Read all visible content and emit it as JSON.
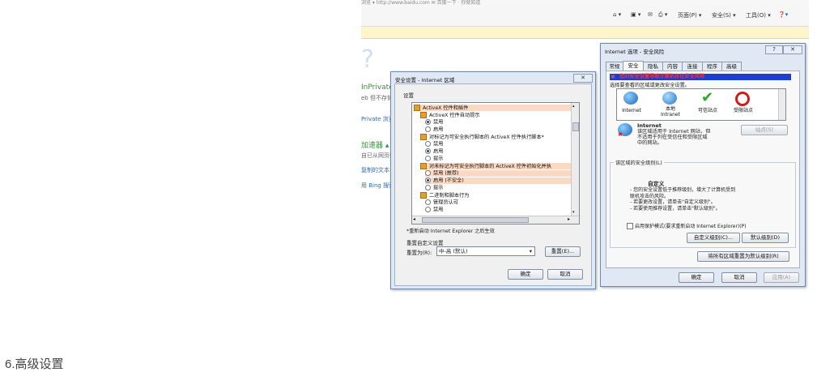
{
  "caption": "6.高级设置",
  "browser": {
    "top_strip": "浏览 ▾  http://www.baidu.com   ✉ 百度一下 · 你就知道",
    "commands": [
      "页面(P) ▾",
      "安全(S) ▾",
      "工具(O) ▾"
    ],
    "page_text": {
      "qmark": "?",
      "line1": "InPrivate",
      "line2": "eb 但不存储",
      "line3": "Private 浏览",
      "line4": "加速器 ▴",
      "line5": "自已从网页中",
      "line6": "复制的文本",
      "line7": "用 Bing 搜索"
    }
  },
  "security_settings": {
    "title": "安全设置 - Internet 区域",
    "settings_label": "设置",
    "items": [
      {
        "kind": "category",
        "text": "ActiveX 控件和插件",
        "highlight": true
      },
      {
        "kind": "category",
        "text": "ActiveX 控件自动提示",
        "highlight": false
      },
      {
        "kind": "radio",
        "text": "禁用",
        "checked": true,
        "highlight": false
      },
      {
        "kind": "radio",
        "text": "启用",
        "checked": false,
        "highlight": false
      },
      {
        "kind": "category",
        "text": "对标记为可安全执行脚本的 ActiveX 控件执行脚本*",
        "highlight": false
      },
      {
        "kind": "radio",
        "text": "禁用",
        "checked": false,
        "highlight": false
      },
      {
        "kind": "radio",
        "text": "启用",
        "checked": true,
        "highlight": false
      },
      {
        "kind": "radio",
        "text": "提示",
        "checked": false,
        "highlight": false
      },
      {
        "kind": "category",
        "text": "对未标记为可安全执行脚本的 ActiveX 控件初始化并执",
        "highlight": true
      },
      {
        "kind": "radio",
        "text": "禁用 (推荐)",
        "checked": false,
        "highlight": true
      },
      {
        "kind": "radio",
        "text": "启用 (不安全)",
        "checked": true,
        "highlight": true
      },
      {
        "kind": "radio",
        "text": "提示",
        "checked": false,
        "highlight": false
      },
      {
        "kind": "category",
        "text": "二进制和脚本行为",
        "highlight": false
      },
      {
        "kind": "radio",
        "text": "管理员认可",
        "checked": false,
        "highlight": false
      },
      {
        "kind": "radio",
        "text": "禁用",
        "checked": false,
        "highlight": false
      }
    ],
    "restart_note": "*重新启动 Internet Explorer 之后生效",
    "reset_section": "重置自定义设置",
    "reset_to_label": "重置为(R):",
    "reset_select": "中-高 (默认)",
    "reset_button": "重置(E)...",
    "ok": "确定",
    "cancel": "取消"
  },
  "internet_options": {
    "title": "Internet 选项 - 安全风险",
    "tabs": [
      "常规",
      "安全",
      "隐私",
      "内容",
      "连接",
      "程序",
      "高级"
    ],
    "warning": "您的安全设置导致计算机存在安全风险",
    "instruction": "选择要查看的区域或更改安全设置。",
    "zones": [
      {
        "line1": "Internet",
        "line2": ""
      },
      {
        "line1": "本地",
        "line2": "Intranet"
      },
      {
        "line1": "可信站点",
        "line2": ""
      },
      {
        "line1": "受限站点",
        "line2": ""
      }
    ],
    "zone_name": "Internet",
    "zone_desc": [
      "该区域适用于 Internet 网站，但",
      "不适用于列在受信任和受限区域",
      "中的网站。"
    ],
    "sites_button": "站点(S)",
    "level_group": "该区域的安全级别(L)",
    "custom_title": "自定义",
    "custom_lines": [
      "- 您的安全设置低于推荐级别，增大了计算机受到",
      "联机攻击的风险。",
      "- 若要更改设置，请单击\"自定义级别\"。",
      "- 若要使用推荐设置，请单击\"默认级别\"。"
    ],
    "protected_mode": "启用保护模式(要求重新启动 Internet Explorer)(P)",
    "custom_level_button": "自定义级别(C)...",
    "default_level_button": "默认级别(D)",
    "reset_all_button": "将所有区域重置为默认级别(R)",
    "ok": "确定",
    "cancel": "取消",
    "apply": "应用(A)",
    "help": "?",
    "close": "✕"
  }
}
